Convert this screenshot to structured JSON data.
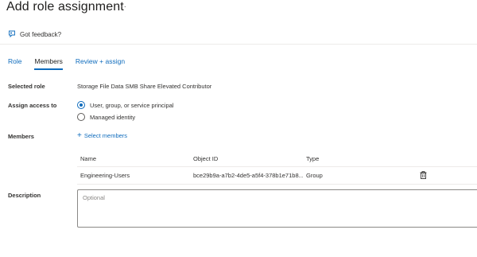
{
  "header": {
    "title": "Add role assignment",
    "more": "···"
  },
  "feedback": {
    "label": "Got feedback?",
    "icon": "feedback-icon"
  },
  "tabs": [
    {
      "label": "Role",
      "active": false
    },
    {
      "label": "Members",
      "active": true
    },
    {
      "label": "Review + assign",
      "active": false
    }
  ],
  "selected_role": {
    "label": "Selected role",
    "value": "Storage File Data SMB Share Elevated Contributor"
  },
  "assign_access": {
    "label": "Assign access to",
    "options": [
      {
        "label": "User, group, or service principal",
        "checked": true
      },
      {
        "label": "Managed identity",
        "checked": false
      }
    ]
  },
  "members": {
    "label": "Members",
    "select_link": "Select members",
    "columns": [
      "Name",
      "Object ID",
      "Type"
    ],
    "rows": [
      {
        "name": "Engineering-Users",
        "object_id": "bce29b9a-a7b2-4de5-a5f4-378b1e71b8...",
        "type": "Group"
      }
    ]
  },
  "description": {
    "label": "Description",
    "placeholder": "Optional",
    "value": ""
  },
  "colors": {
    "accent": "#0f6cbd",
    "text": "#323130",
    "border": "#8a8886"
  }
}
